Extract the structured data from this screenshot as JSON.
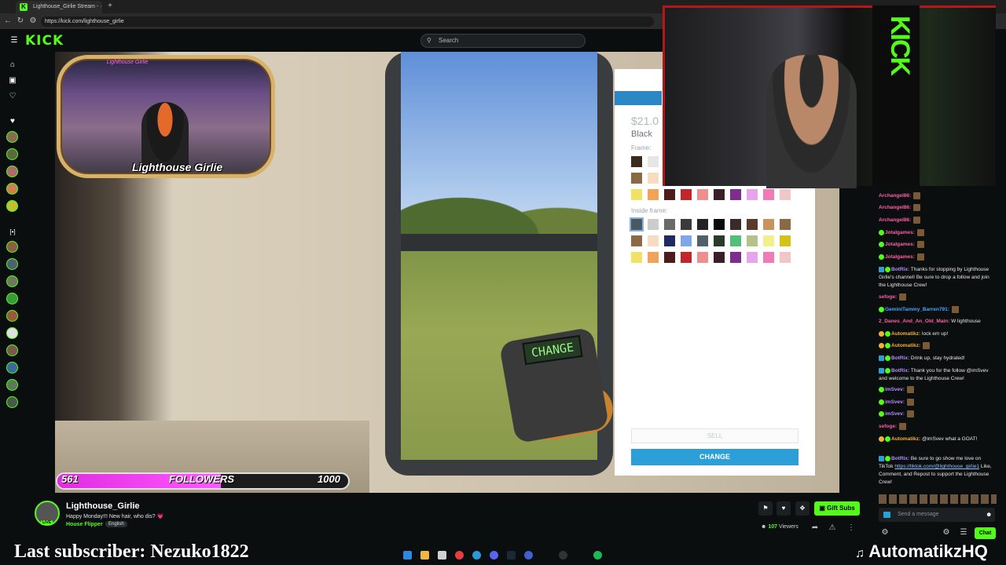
{
  "browser": {
    "tab_title": "Lighthouse_Girlie Stream - ·",
    "tab_icon": "kick-icon",
    "url": "https://kick.com/lighthouse_girlie"
  },
  "header": {
    "logo": "KICK",
    "search_placeholder": "Search"
  },
  "stream": {
    "webcam_logo": "Lighthouse Girlie",
    "device_text": "CHANGE",
    "followers": {
      "current": "561",
      "label": "FOLLOWERS",
      "goal": "1000",
      "progress": 0.561
    },
    "panel": {
      "price": "$21.0",
      "name": "Black",
      "frame_label": "Frame:",
      "inside_frame_label": "Inside frame:",
      "sell_label": "SELL",
      "change_label": "CHANGE",
      "frame_swatches": [
        "#3b2a1e",
        "#e6e6e6",
        "#8a6a45",
        "#f7dcc2",
        "#f3e163",
        "#f2a35a",
        "#4e1a1a",
        "#c2262b",
        "#f08d8d",
        "#3a1f2a",
        "#7e2d8f",
        "#e7a3ec",
        "#f27bb5",
        "#f1c6c6"
      ],
      "inside_swatches": [
        "#4c5761",
        "#cccccc",
        "#6a6a6a",
        "#3a3a3a",
        "#232323",
        "#0a0a0a",
        "#3a2a2a",
        "#5a3b2b",
        "#c8945c",
        "#8a6a45",
        "#8b6a45",
        "#f7dcc2",
        "#1f2a5e",
        "#7ea6e8",
        "#52606b",
        "#2a3b2a",
        "#4fbf7a",
        "#b4c28a",
        "#f1f08a",
        "#d3c21a",
        "#f3e163",
        "#f2a35a",
        "#4e1a1a",
        "#c2262b",
        "#f08d8d",
        "#3a1f2a",
        "#7e2d8f",
        "#e7a3ec",
        "#f27bb5",
        "#f1c6c6"
      ]
    }
  },
  "channel": {
    "name": "Lighthouse_Girlie",
    "title": "Happy Monday!!! New hair, who dis? 💗",
    "category": "House Flipper",
    "language": "English",
    "live_badge": "LIVE",
    "gift_label": "Gift Subs",
    "viewers": "107",
    "viewers_label": "Viewers"
  },
  "chat": {
    "messages": [
      {
        "user": "Archangel86",
        "color": "#ff5ea8",
        "text": ""
      },
      {
        "user": "Archangel86",
        "color": "#ff5ea8",
        "text": ""
      },
      {
        "user": "Archangel86",
        "color": "#ff5ea8",
        "text": ""
      },
      {
        "user": "Jotalgames",
        "color": "#ff5ea8",
        "text": ""
      },
      {
        "user": "Jotalgames",
        "color": "#ff5ea8",
        "text": ""
      },
      {
        "user": "Jotalgames",
        "color": "#ff5ea8",
        "text": ""
      },
      {
        "user": "BotRix",
        "color": "#b38bff",
        "text": "Thanks for stopping by Lighthouse Girlie's channel! Be sure to drop a follow and join the Lighthouse Crew!"
      },
      {
        "user": "sefoge",
        "color": "#ff5ea8",
        "text": ""
      },
      {
        "user": "GeminiTammy_Barren791",
        "color": "#4aa3ff",
        "text": ""
      },
      {
        "user": "2_Danes_And_An_Old_Main",
        "color": "#ff5ea8",
        "text": "W lighthouse"
      },
      {
        "user": "Automatikz",
        "color": "#f5b031",
        "text": "lock em up!"
      },
      {
        "user": "Automatikz",
        "color": "#f5b031",
        "text": ""
      },
      {
        "user": "BotRix",
        "color": "#b38bff",
        "text": "Drink up, stay hydrated!"
      },
      {
        "user": "BotRix",
        "color": "#b38bff",
        "text": "Thank you for the follow @imSvev and welcome to the Lighthouse Crew!"
      },
      {
        "user": "imSvev",
        "color": "#b38bff",
        "text": ""
      },
      {
        "user": "imSvev",
        "color": "#b38bff",
        "text": ""
      },
      {
        "user": "imSvev",
        "color": "#b38bff",
        "text": ""
      },
      {
        "user": "sefoge",
        "color": "#ff5ea8",
        "text": ""
      },
      {
        "user": "Automatikz",
        "color": "#f5b031",
        "text": "@imSvev what a GOAT!"
      },
      {
        "user": "BotRix",
        "color": "#b38bff",
        "text": "Be sure to go show me love on TikTok "
      }
    ],
    "botrix_link": "https://tiktok.com/@lighthouse_girlie1",
    "botrix_tail": " Like, Comment, and Repost to support the Lighthouse Crew!",
    "input_placeholder": "Send a message",
    "chat_button": "Chat"
  },
  "overlay": {
    "last_subscriber_label": "Last subscriber:",
    "last_subscriber": "Nezuko1822",
    "handle": "AutomatikzHQ"
  },
  "colors": {
    "kick_green": "#53fc18",
    "follower_bar": "#e02ce0",
    "panel_blue": "#2c9fd9"
  }
}
